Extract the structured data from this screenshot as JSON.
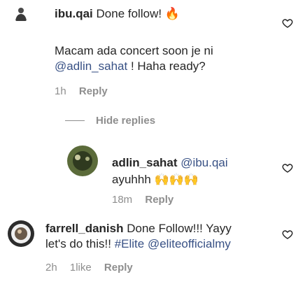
{
  "comments": [
    {
      "username": "ibu.qai",
      "text": "Done follow!",
      "time": "",
      "reply_label": ""
    }
  ],
  "c1": {
    "username": "ibu.qai",
    "line1": "Done follow!",
    "emoji": "🔥",
    "body_line1": "Macam ada concert soon je ni",
    "mention": "@adlin_sahat",
    "body_line2_rest": " ! Haha ready?",
    "time": "1h",
    "reply_label": "Reply"
  },
  "hide_replies_label": "Hide replies",
  "c2": {
    "username": "adlin_sahat",
    "mention": "@ibu.qai",
    "text": "ayuhhh",
    "emoji": "🙌🙌🙌",
    "time": "18m",
    "reply_label": "Reply"
  },
  "c3": {
    "username": "farrell_danish",
    "text_line1": "Done Follow!!! Yayy",
    "text_line2_a": "let's do this!! ",
    "hashtag": "#Elite",
    "mention": "@eliteofficialmy",
    "time": "2h",
    "likes": "1like",
    "reply_label": "Reply"
  },
  "colors": {
    "text": "#262626",
    "muted": "#8e8e8e",
    "link": "#385185"
  },
  "icons": [
    "heart-icon"
  ]
}
